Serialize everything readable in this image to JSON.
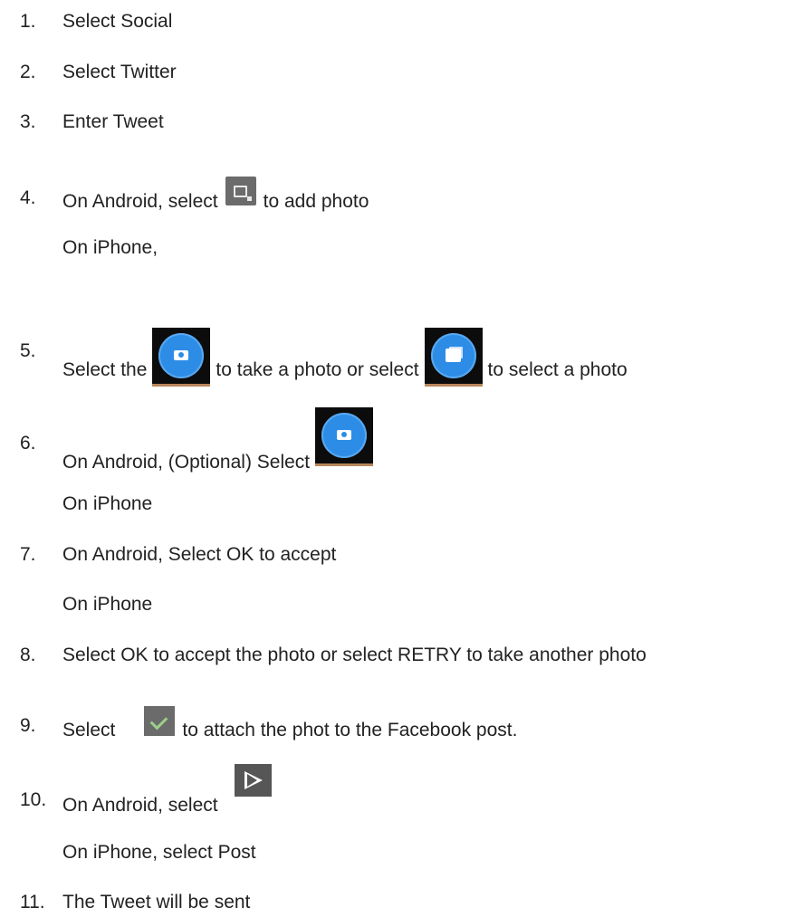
{
  "steps": [
    {
      "num": "1.",
      "text": "Select Social"
    },
    {
      "num": "2.",
      "text": "Select Twitter"
    },
    {
      "num": "3.",
      "text": "Enter Tweet"
    },
    {
      "num": "4.",
      "text_a": "On Android, select",
      "icon": "image-gallery-icon",
      "text_b": "to add photo",
      "sub": "On iPhone,"
    },
    {
      "num": "5.",
      "text_a": "Select the",
      "icon_a": "camera-icon",
      "text_b": "to take a photo or select",
      "icon_b": "photo-gallery-icon",
      "text_c": "to select a photo"
    },
    {
      "num": "6.",
      "text_a": "On Android, (Optional) Select",
      "icon": "camera-icon",
      "sub": "On iPhone"
    },
    {
      "num": "7.",
      "text": "On Android, Select OK to accept",
      "sub": "On iPhone"
    },
    {
      "num": "8.",
      "text": "Select OK to accept the photo or select RETRY to take another photo"
    },
    {
      "num": "9.",
      "text_a": "Select",
      "icon": "checkmark-icon",
      "text_b": "to attach the phot to the Facebook post."
    },
    {
      "num": "10.",
      "text_a": "On Android, select",
      "icon": "send-icon",
      "sub": "On iPhone, select Post"
    },
    {
      "num": "11.",
      "text": "The Tweet will be sent"
    }
  ]
}
